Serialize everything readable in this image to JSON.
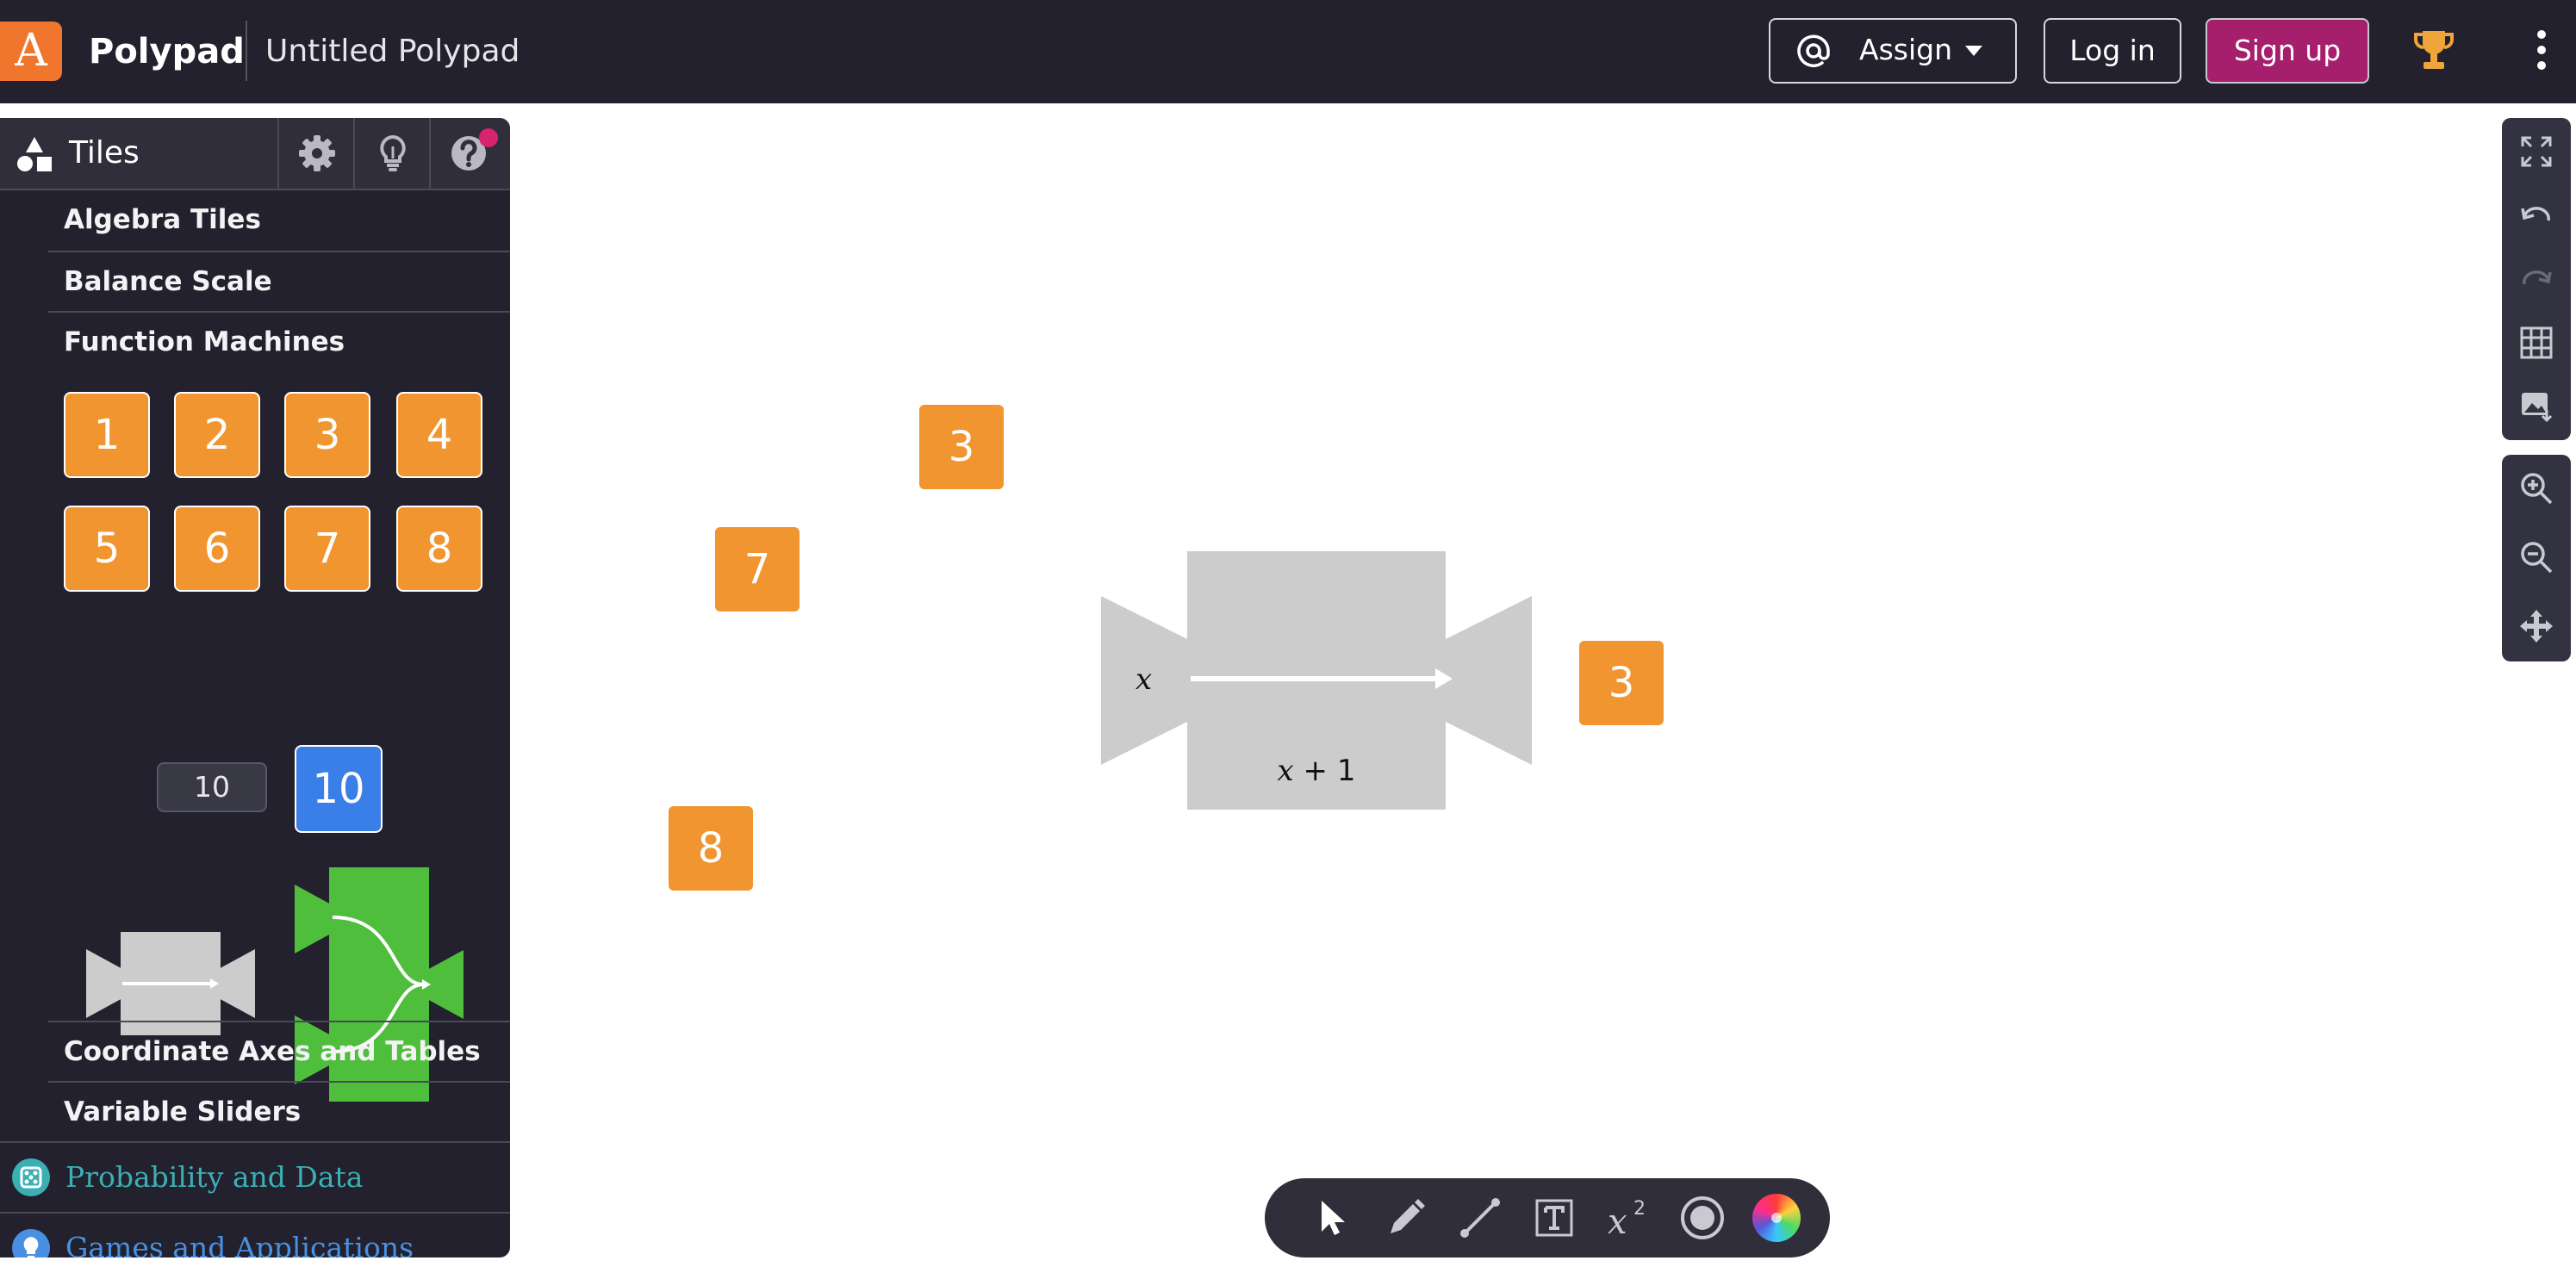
{
  "header": {
    "logo_letter": "A",
    "app_name": "Polypad",
    "document_title": "Untitled Polypad",
    "assign_label": "Assign",
    "login_label": "Log in",
    "signup_label": "Sign up"
  },
  "panel": {
    "title": "Tiles",
    "categories": [
      "Algebra Tiles",
      "Balance Scale",
      "Function Machines"
    ],
    "number_tiles": [
      "1",
      "2",
      "3",
      "4",
      "5",
      "6",
      "7",
      "8"
    ],
    "tile_count_value": "10",
    "custom_tile": "10",
    "lower_categories": [
      "Coordinate Axes and Tables",
      "Variable Sliders"
    ],
    "sections": [
      {
        "label": "Probability and Data",
        "icon": "dice-icon",
        "color": "#3ab0b5"
      },
      {
        "label": "Games and Applications",
        "icon": "lightbulb-icon",
        "color": "#4a90e2"
      }
    ]
  },
  "canvas": {
    "tiles": [
      "3",
      "7",
      "8",
      "3"
    ],
    "machine": {
      "input_var": "x",
      "rule": "+ 1",
      "rule_var": "x"
    }
  },
  "colors": {
    "topbar": "#22212d",
    "logo": "#f0752d",
    "signup": "#a51f6d",
    "tile_orange": "#f0952f",
    "tile_blue": "#3a7ee8",
    "machine_gray": "#cccccc",
    "split_green": "#4fbe3c"
  }
}
